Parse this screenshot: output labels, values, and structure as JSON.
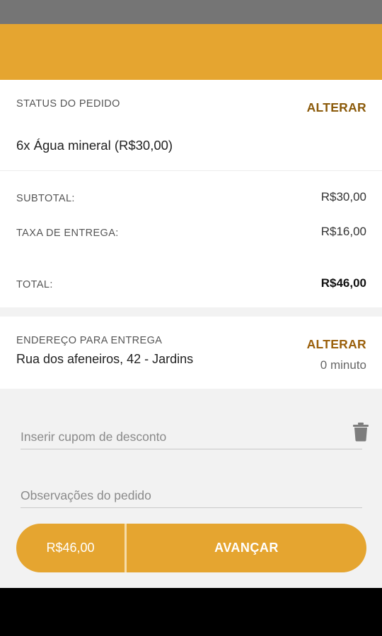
{
  "order": {
    "status_label": "STATUS DO PEDIDO",
    "alter_label": "ALTERAR",
    "item": "6x Água mineral (R$30,00)"
  },
  "totals": {
    "subtotal_label": "SUBTOTAL:",
    "subtotal_value": "R$30,00",
    "fee_label": "TAXA DE ENTREGA:",
    "fee_value": "R$16,00",
    "total_label": "TOTAL:",
    "total_value": "R$46,00"
  },
  "address": {
    "label": "ENDEREÇO PARA ENTREGA",
    "alter_label": "ALTERAR",
    "text": "Rua dos afeneiros, 42 - Jardins",
    "time": "0 minuto"
  },
  "coupon": {
    "placeholder": "Inserir cupom de desconto",
    "icon": "trash-icon"
  },
  "notes": {
    "placeholder": "Observações do pedido"
  },
  "footer": {
    "price": "R$46,00",
    "advance_label": "AVANÇAR"
  },
  "colors": {
    "accent": "#e5a530",
    "link": "#8b5a0a",
    "status_bar": "#757575",
    "background": "#f2f2f2"
  }
}
